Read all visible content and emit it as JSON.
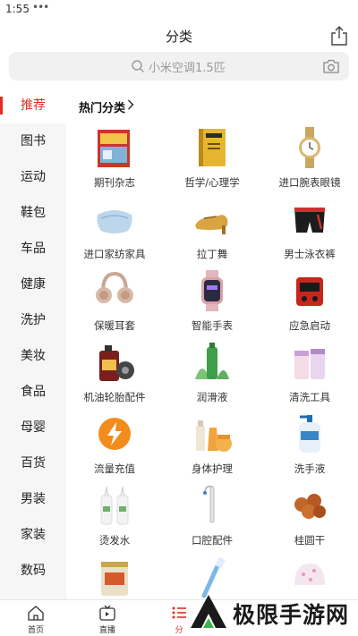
{
  "status": {
    "time": "1:55",
    "dots": "•••"
  },
  "header": {
    "title": "分类"
  },
  "search": {
    "placeholder": "小米空调1.5匹"
  },
  "sidebar": {
    "items": [
      {
        "label": "推荐"
      },
      {
        "label": "图书"
      },
      {
        "label": "运动"
      },
      {
        "label": "鞋包"
      },
      {
        "label": "车品"
      },
      {
        "label": "健康"
      },
      {
        "label": "洗护"
      },
      {
        "label": "美妆"
      },
      {
        "label": "食品"
      },
      {
        "label": "母婴"
      },
      {
        "label": "百货"
      },
      {
        "label": "男装"
      },
      {
        "label": "家装"
      },
      {
        "label": "数码"
      }
    ]
  },
  "section": {
    "title": "热门分类"
  },
  "categories": [
    {
      "label": "期刊杂志",
      "icon": "magazine-icon"
    },
    {
      "label": "哲学/心理学",
      "icon": "book-icon"
    },
    {
      "label": "进口腕表眼镜",
      "icon": "watch-icon"
    },
    {
      "label": "进口家纺家具",
      "icon": "pillow-icon"
    },
    {
      "label": "拉丁舞",
      "icon": "dance-shoe-icon"
    },
    {
      "label": "男士泳衣裤",
      "icon": "swim-trunks-icon"
    },
    {
      "label": "保暖耳套",
      "icon": "earmuff-icon"
    },
    {
      "label": "智能手表",
      "icon": "smartwatch-icon"
    },
    {
      "label": "应急启动",
      "icon": "jump-starter-icon"
    },
    {
      "label": "机油轮胎配件",
      "icon": "motor-oil-icon"
    },
    {
      "label": "润滑液",
      "icon": "lubricant-icon"
    },
    {
      "label": "清洗工具",
      "icon": "cleaning-jar-icon"
    },
    {
      "label": "流量充值",
      "icon": "lightning-icon"
    },
    {
      "label": "身体护理",
      "icon": "body-care-icon"
    },
    {
      "label": "洗手液",
      "icon": "hand-soap-icon"
    },
    {
      "label": "烫发水",
      "icon": "perm-lotion-icon"
    },
    {
      "label": "口腔配件",
      "icon": "dental-tool-icon"
    },
    {
      "label": "桂圆干",
      "icon": "dried-longan-icon"
    },
    {
      "label": "",
      "icon": "canned-food-icon"
    },
    {
      "label": "",
      "icon": "toothbrush-icon"
    },
    {
      "label": "",
      "icon": "baby-hat-icon"
    }
  ],
  "bottom_nav": [
    {
      "label": "首页",
      "icon": "home-icon"
    },
    {
      "label": "直播",
      "icon": "tv-icon"
    },
    {
      "label": "分",
      "icon": "list-icon"
    }
  ],
  "watermark": {
    "text": "极限手游网"
  },
  "colors": {
    "accent": "#e02e24",
    "sidebar_bg": "#f6f6f6",
    "search_bg": "#f1f1f1"
  }
}
